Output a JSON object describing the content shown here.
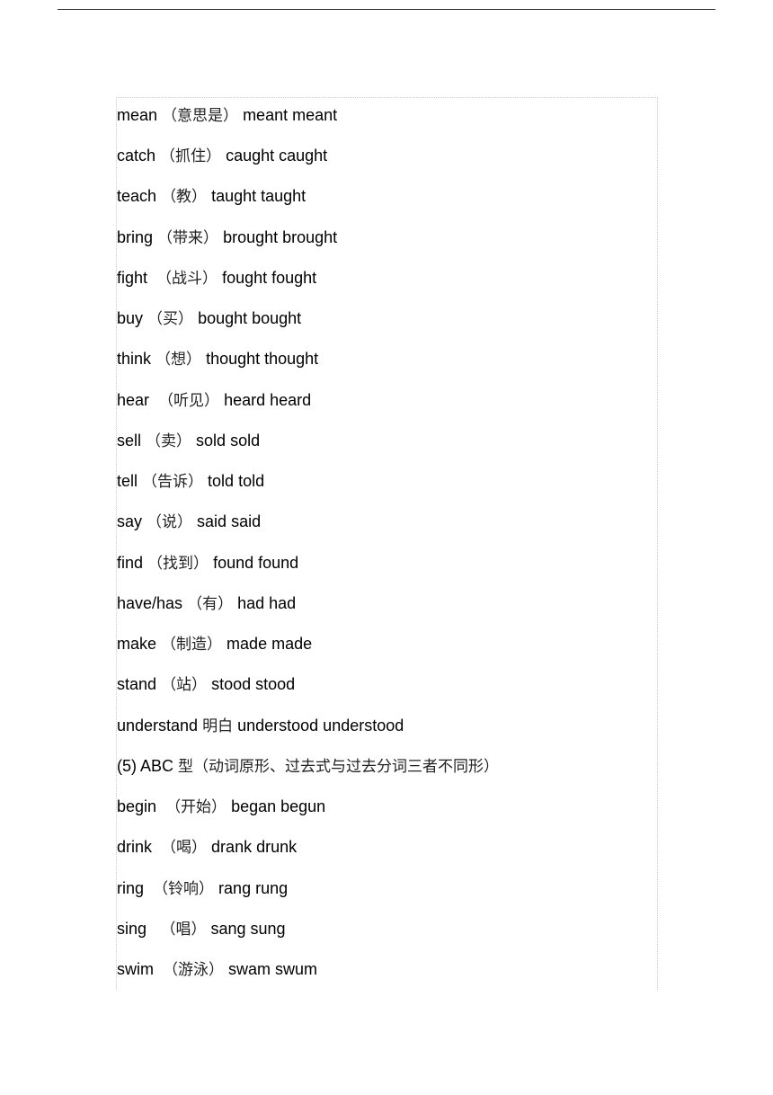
{
  "lines": [
    {
      "base": "mean",
      "cn": "（意思是）",
      "forms": "meant meant"
    },
    {
      "base": "catch",
      "cn": "（抓住）",
      "forms": "caught caught"
    },
    {
      "base": "teach",
      "cn": "（教）",
      "forms": "taught taught"
    },
    {
      "base": "bring",
      "cn": "（带来）",
      "forms": "brought brought"
    },
    {
      "base": "fight ",
      "cn": "（战斗）",
      "forms": "fought fought"
    },
    {
      "base": "buy",
      "cn": "（买）",
      "forms": "bought bought"
    },
    {
      "base": "think",
      "cn": "（想）",
      "forms": "thought thought"
    },
    {
      "base": "hear ",
      "cn": "（听见）",
      "forms": "heard heard"
    },
    {
      "base": "sell",
      "cn": "（卖）",
      "forms": "sold sold"
    },
    {
      "base": "tell",
      "cn": "（告诉）",
      "forms": "told told"
    },
    {
      "base": "say",
      "cn": "（说）",
      "forms": "said said"
    },
    {
      "base": "find",
      "cn": "（找到）",
      "forms": "found found"
    },
    {
      "base": "have/has",
      "cn": "（有）",
      "forms": "had had"
    },
    {
      "base": "make",
      "cn": "（制造）",
      "forms": "made made"
    },
    {
      "base": "stand",
      "cn": "（站）",
      "forms": "stood stood"
    },
    {
      "base": "understand",
      "cn": "明白",
      "forms": "understood understood"
    },
    {
      "base": "(5) ABC",
      "cn": "型（动词原形、过去式与过去分词三者不同形）",
      "forms": ""
    },
    {
      "base": "begin ",
      "cn": "（开始）",
      "forms": "began begun"
    },
    {
      "base": "drink ",
      "cn": "（喝）",
      "forms": "drank drunk"
    },
    {
      "base": "ring ",
      "cn": "（铃响）",
      "forms": "rang rung"
    },
    {
      "base": "sing ",
      "cn": " （唱）",
      "forms": "sang sung"
    },
    {
      "base": "swim ",
      "cn": "（游泳）",
      "forms": "swam swum"
    }
  ]
}
